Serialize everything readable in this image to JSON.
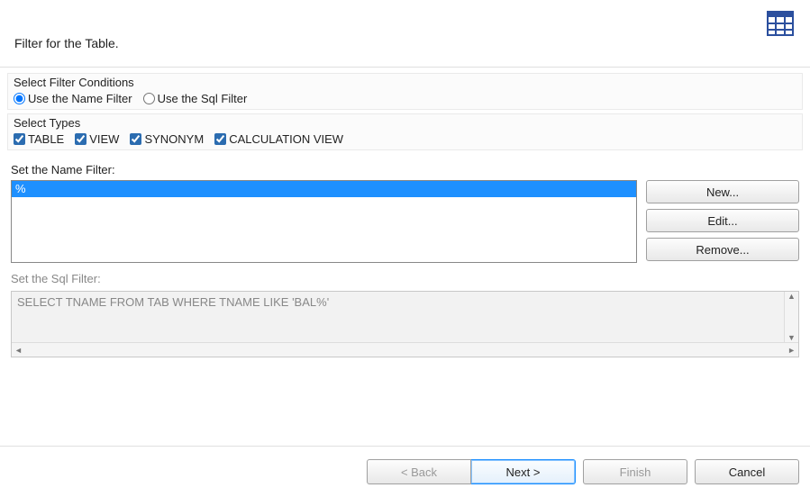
{
  "header": {
    "title": "Filter for the Table.",
    "icon": "table-grid-icon"
  },
  "filterConditions": {
    "groupLabel": "Select Filter Conditions",
    "option_name": "Use the Name Filter",
    "option_sql": "Use the Sql Filter",
    "selected": "name"
  },
  "selectTypes": {
    "groupLabel": "Select Types",
    "types": [
      {
        "label": "TABLE",
        "checked": true
      },
      {
        "label": "VIEW",
        "checked": true
      },
      {
        "label": "SYNONYM",
        "checked": true
      },
      {
        "label": "CALCULATION VIEW",
        "checked": true
      }
    ]
  },
  "nameFilter": {
    "label": "Set the Name Filter:",
    "items": [
      "%"
    ],
    "buttons": {
      "new": "New...",
      "edit": "Edit...",
      "remove": "Remove..."
    }
  },
  "sqlFilter": {
    "label": "Set the Sql Filter:",
    "text": "SELECT TNAME FROM TAB WHERE TNAME LIKE 'BAL%'",
    "enabled": false
  },
  "wizard": {
    "back": "< Back",
    "next": "Next >",
    "finish": "Finish",
    "cancel": "Cancel"
  }
}
